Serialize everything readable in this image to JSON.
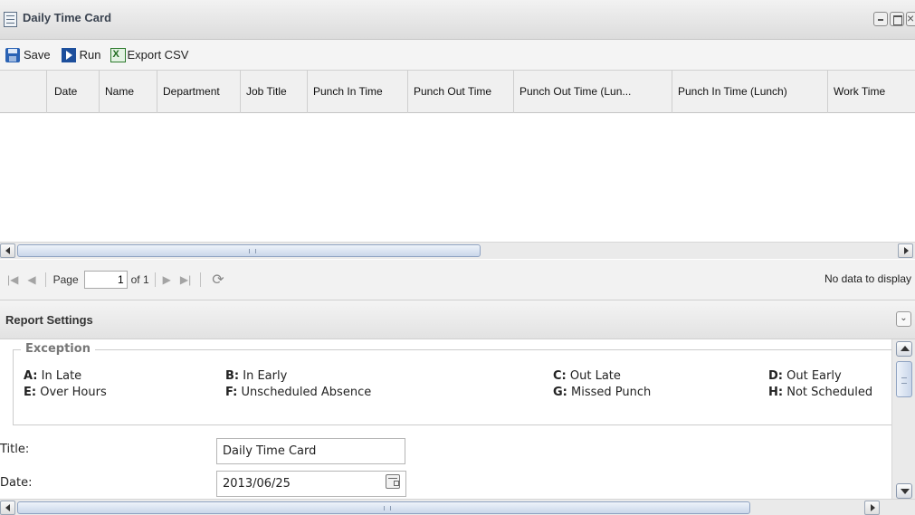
{
  "window": {
    "title": "Daily Time Card"
  },
  "toolbar": {
    "save_label": "Save",
    "run_label": "Run",
    "export_label": "Export CSV"
  },
  "grid": {
    "columns": [
      "",
      "Date",
      "Name",
      "Department",
      "Job Title",
      "Punch In Time",
      "Punch Out Time",
      "Punch Out Time (Lun...",
      "Punch In Time (Lunch)",
      "Work Time"
    ],
    "rows": []
  },
  "pager": {
    "page_label": "Page",
    "page_value": "1",
    "of_label": "of 1",
    "status": "No data to display"
  },
  "report_settings": {
    "title": "Report Settings",
    "exception_legend": "Exception",
    "exceptions": [
      {
        "code": "A:",
        "label": "In Late"
      },
      {
        "code": "B:",
        "label": "In Early"
      },
      {
        "code": "C:",
        "label": "Out Late"
      },
      {
        "code": "D:",
        "label": "Out Early"
      },
      {
        "code": "E:",
        "label": "Over Hours"
      },
      {
        "code": "F:",
        "label": "Unscheduled Absence"
      },
      {
        "code": "G:",
        "label": "Missed Punch"
      },
      {
        "code": "H:",
        "label": "Not Scheduled"
      }
    ],
    "title_label": "Title:",
    "title_value": "Daily Time Card",
    "date_label": "Date:",
    "date_value": "2013/06/25"
  }
}
